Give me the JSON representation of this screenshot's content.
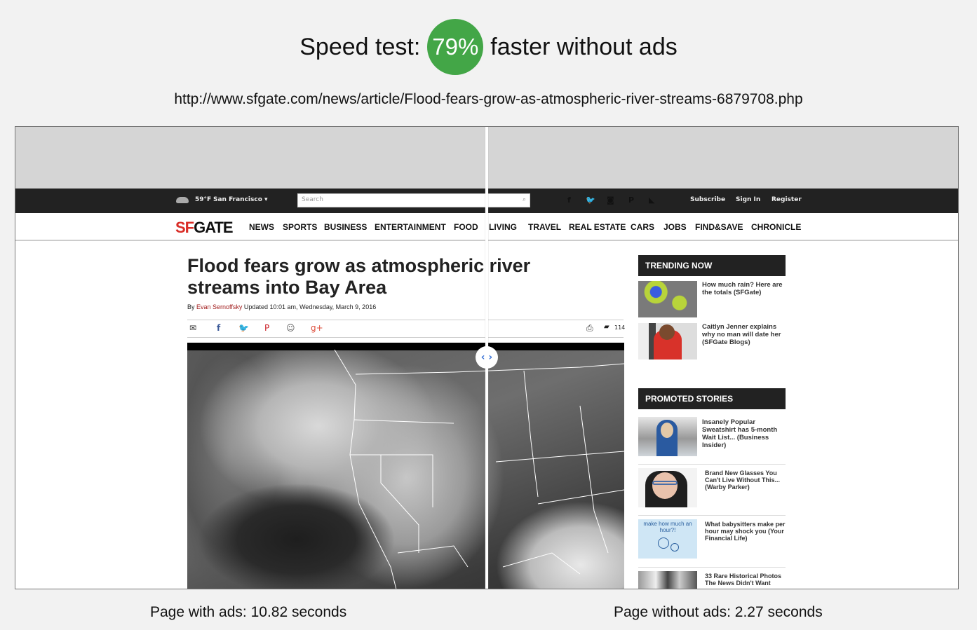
{
  "header": {
    "prefix": "Speed test:",
    "badge_value": "79%",
    "suffix": "faster without ads",
    "badge_color": "#43a647"
  },
  "url": "http://www.sfgate.com/news/article/Flood-fears-grow-as-atmospheric-river-streams-6879708.php",
  "site": {
    "topbar": {
      "weather_icon": "cloud-icon",
      "temperature": "59°F",
      "city": "San Francisco ▾",
      "search_placeholder": "Search",
      "search_icon": "⌕",
      "social": [
        {
          "name": "facebook-icon",
          "glyph": "f",
          "color": "#3b5998"
        },
        {
          "name": "twitter-icon",
          "glyph": "🐦",
          "color": "#1da1f2"
        },
        {
          "name": "instagram-icon",
          "glyph": "◙",
          "color": "#3f729b"
        },
        {
          "name": "pinterest-icon",
          "glyph": "P",
          "color": "#cb2027"
        },
        {
          "name": "rss-icon",
          "glyph": "◣",
          "color": "#f26522"
        }
      ],
      "links": [
        "Subscribe",
        "Sign In",
        "Register"
      ]
    },
    "logo": {
      "sf": "SF",
      "gate": "GATE"
    },
    "nav": [
      "NEWS",
      "SPORTS",
      "BUSINESS",
      "ENTERTAINMENT",
      "FOOD",
      "LIVING",
      "TRAVEL",
      "REAL ESTATE",
      "CARS",
      "JOBS",
      "FIND&SAVE",
      "CHRONICLE"
    ],
    "article": {
      "title": "Flood fears grow as atmospheric river streams into Bay Area",
      "by": "By",
      "author": "Evan Sernoffsky",
      "updated": "Updated 10:01 am, Wednesday, March 9, 2016",
      "share_icons": [
        {
          "name": "email-icon",
          "glyph": "✉",
          "color": "#333"
        },
        {
          "name": "facebook-icon",
          "glyph": "f",
          "color": "#3b5998"
        },
        {
          "name": "twitter-icon",
          "glyph": "🐦",
          "color": "#1da1f2"
        },
        {
          "name": "pinterest-icon",
          "glyph": "P",
          "color": "#cb2027"
        },
        {
          "name": "reddit-icon",
          "glyph": "☺",
          "color": "#555"
        },
        {
          "name": "google-plus-icon",
          "glyph": "g+",
          "color": "#dd4b39"
        }
      ],
      "print_icon": "⎙",
      "comments_icon": "▰",
      "comment_count": "114"
    },
    "sidebar": {
      "trending_title": "TRENDING NOW",
      "trending": [
        {
          "text": "How much rain? Here are the totals (SFGate)"
        },
        {
          "text": "Caitlyn Jenner explains why no man will date her (SFGate Blogs)"
        }
      ],
      "promoted_title": "PROMOTED STORIES",
      "promoted": [
        {
          "text": "Insanely Popular Sweatshirt has 5-month Wait List... (Business Insider)"
        },
        {
          "text": "Brand New Glasses You Can't Live Without This... (Warby Parker)"
        },
        {
          "text": "What babysitters make per hour may shock you (Your Financial Life)",
          "thumb_text": "make how much an hour?!"
        },
        {
          "text": "33 Rare Historical Photos The News Didn't Want"
        }
      ]
    }
  },
  "slider": {
    "handle_glyph": "‹ ›"
  },
  "captions": {
    "with_ads": "Page with ads: 10.82 seconds",
    "without_ads": "Page without ads: 2.27 seconds"
  }
}
